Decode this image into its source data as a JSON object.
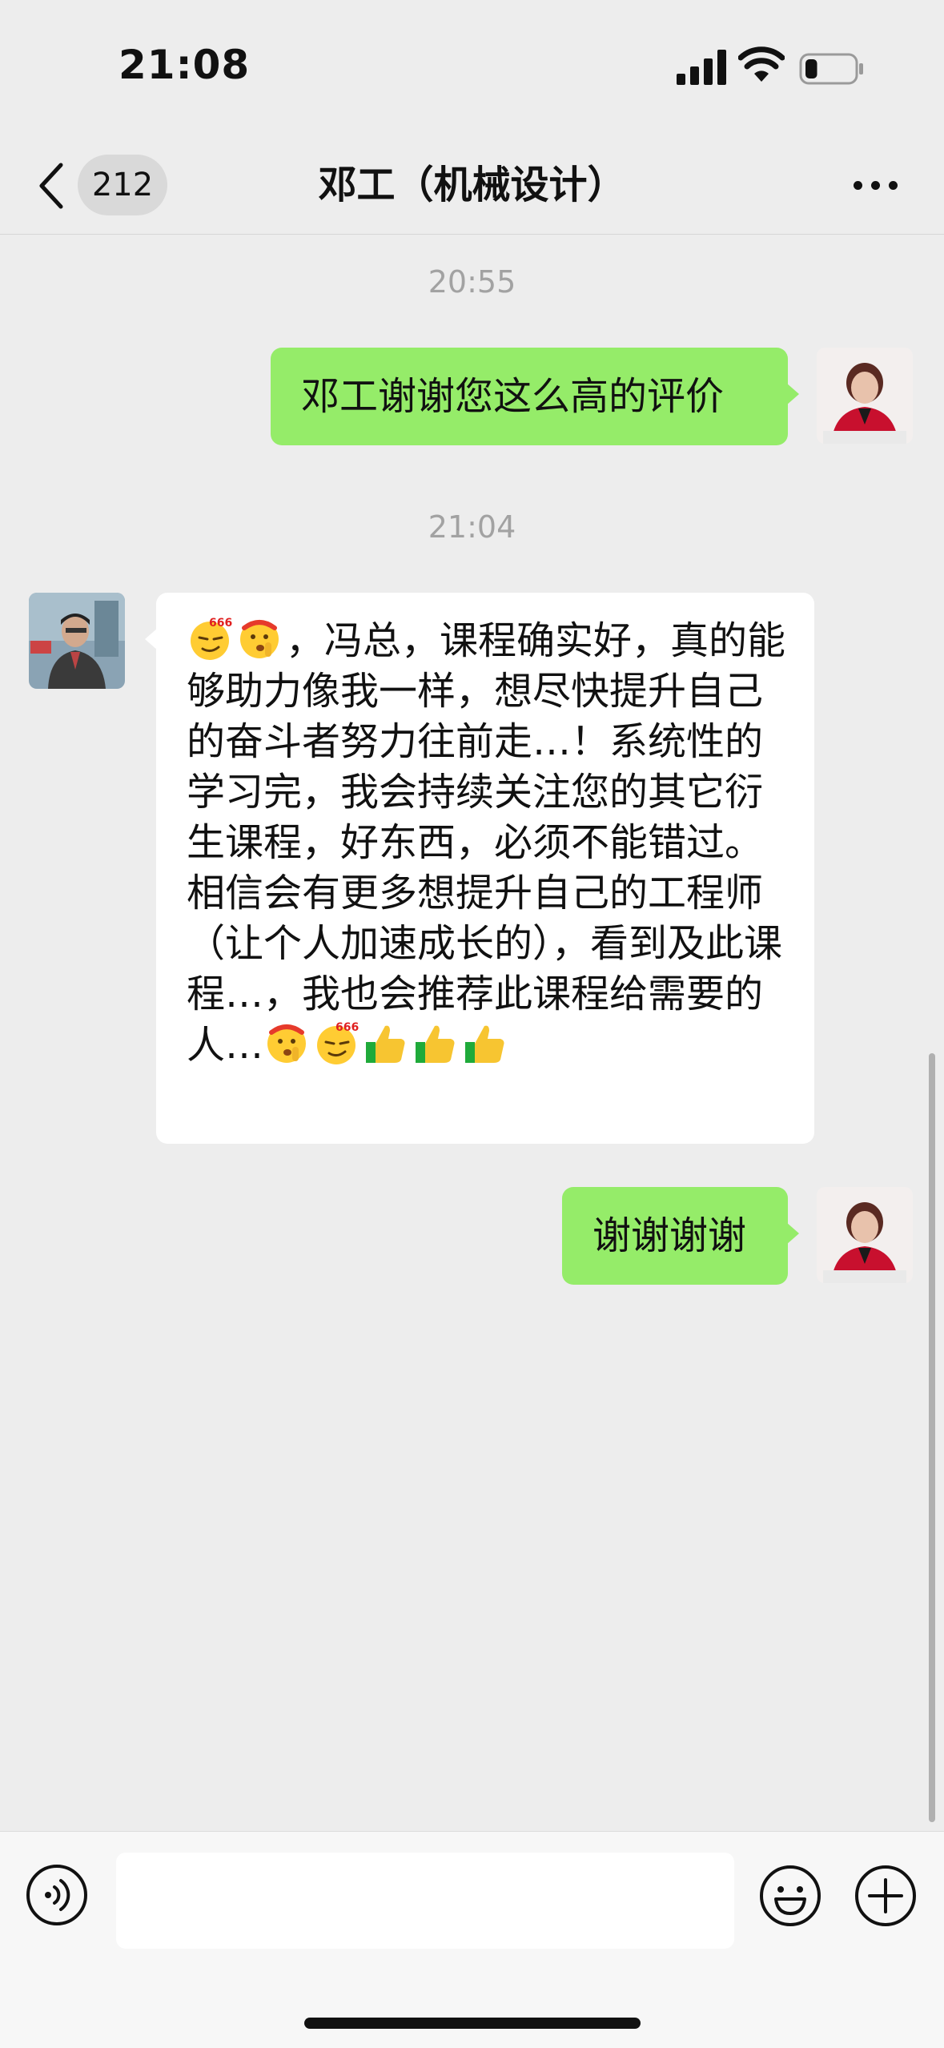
{
  "status_bar": {
    "time": "21:08",
    "battery_level": 0.25
  },
  "nav": {
    "unread_count": "212",
    "title": "邓工（机械设计）"
  },
  "messages": [
    {
      "type": "timestamp",
      "text": "20:55"
    },
    {
      "type": "sent",
      "text": "邓工谢谢您这么高的评价"
    },
    {
      "type": "timestamp",
      "text": "21:04"
    },
    {
      "type": "received",
      "lead_emoji": [
        "smirk-666-emoji",
        "shush-emoji"
      ],
      "text": "，冯总，课程确实好，真的能够助力像我一样，想尽快提升自己的奋斗者努力往前走…！系统性的学习完，我会持续关注您的其它衍生课程，好东西，必须不能错过。相信会有更多想提升自己的工程师（让个人加速成长的），看到及此课程…，我也会推荐此课程给需要的人…",
      "trail_emoji": [
        "shush-emoji",
        "smirk-666-emoji",
        "thumbs-up-emoji",
        "thumbs-up-emoji",
        "thumbs-up-emoji"
      ]
    },
    {
      "type": "sent",
      "text": "谢谢谢谢"
    }
  ],
  "colors": {
    "sent_bubble": "#95ec69",
    "received_bubble": "#ffffff",
    "background": "#ededed"
  },
  "input": {
    "placeholder": ""
  }
}
